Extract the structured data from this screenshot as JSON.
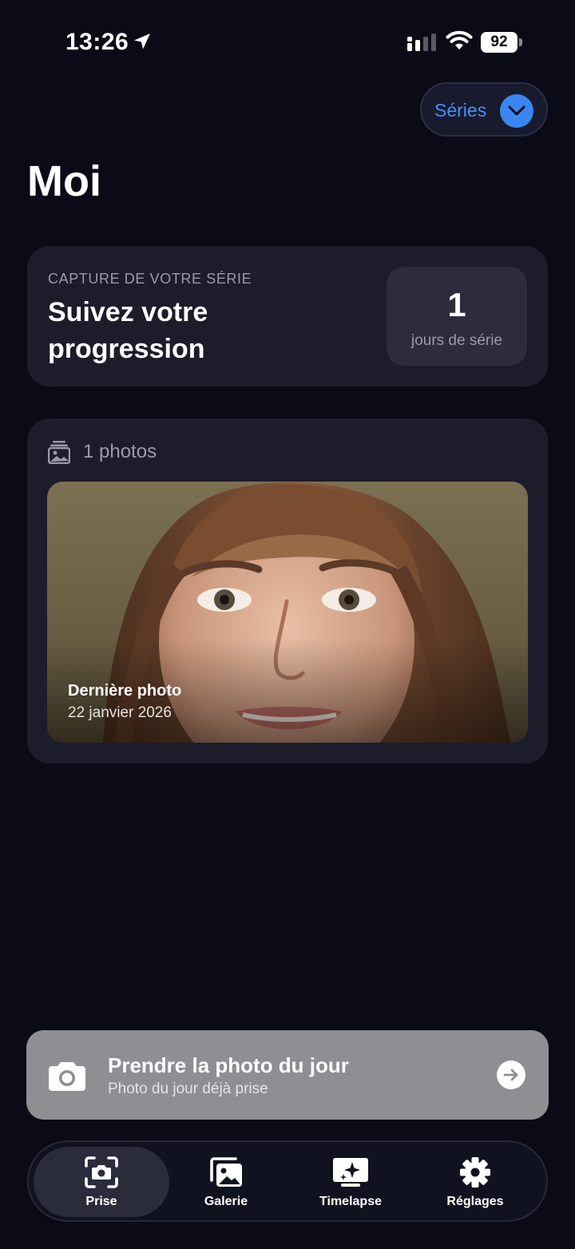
{
  "status_bar": {
    "time": "13:26",
    "battery": "92",
    "icons": [
      "location-arrow-icon",
      "cellular-signal-icon",
      "wifi-icon",
      "battery-icon"
    ]
  },
  "header": {
    "series_button_label": "Séries",
    "title": "Moi"
  },
  "streak_card": {
    "kicker": "CAPTURE DE VOTRE SÉRIE",
    "heading": "Suivez votre progression",
    "count": "1",
    "unit": "jours de série"
  },
  "photos_card": {
    "count_label": "1 photos",
    "latest_title": "Dernière photo",
    "latest_date": "22 janvier 2026"
  },
  "take_photo": {
    "title": "Prendre la photo du jour",
    "subtitle": "Photo du jour déjà prise",
    "background": "#8e8e93"
  },
  "tab_bar": {
    "tabs": [
      {
        "label": "Prise",
        "icon": "camera-viewfinder-icon",
        "active": true
      },
      {
        "label": "Galerie",
        "icon": "photo-stack-icon",
        "active": false
      },
      {
        "label": "Timelapse",
        "icon": "sparkle-screen-icon",
        "active": false
      },
      {
        "label": "Réglages",
        "icon": "gear-icon",
        "active": false
      }
    ]
  },
  "colors": {
    "background": "#0b0b17",
    "card": "#1c1c2b",
    "accent": "#3a86f0"
  }
}
